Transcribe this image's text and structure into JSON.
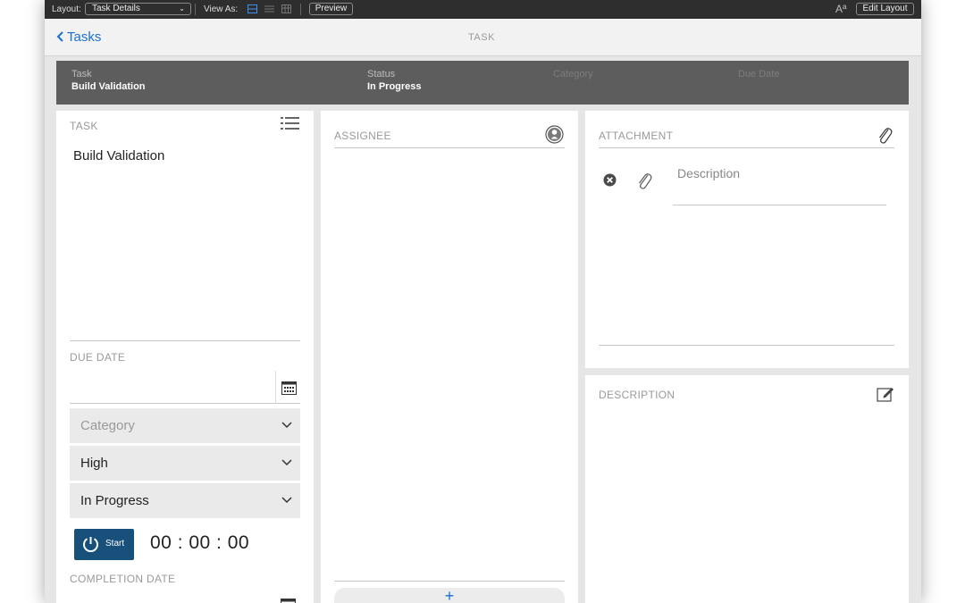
{
  "toolbar": {
    "layout_label": "Layout:",
    "layout_value": "Task Details",
    "view_as_label": "View As:",
    "preview_button": "Preview",
    "font_icon": "Aª",
    "edit_layout_button": "Edit Layout"
  },
  "header": {
    "back_label": "Tasks",
    "title": "TASK"
  },
  "summary": {
    "task_label": "Task",
    "task_value": "Build Validation",
    "status_label": "Status",
    "status_value": "In Progress",
    "category_label": "Category",
    "due_date_label": "Due Date"
  },
  "task_panel": {
    "task_caption": "TASK",
    "task_value": "Build Validation",
    "due_date_caption": "DUE DATE",
    "category_placeholder": "Category",
    "priority_value": "High",
    "status_value": "In Progress",
    "start_button": "Start",
    "timer": "00 : 00 : 00",
    "completion_date_caption": "COMPLETION DATE"
  },
  "assignee_panel": {
    "caption": "ASSIGNEE",
    "add_button": "+"
  },
  "attachment_panel": {
    "caption": "ATTACHMENT",
    "description_placeholder": "Description"
  },
  "description_panel": {
    "caption": "DESCRIPTION"
  },
  "colors": {
    "accent": "#1a6fd6",
    "start_button": "#17507b",
    "summary_bar": "#5d5d5d"
  }
}
